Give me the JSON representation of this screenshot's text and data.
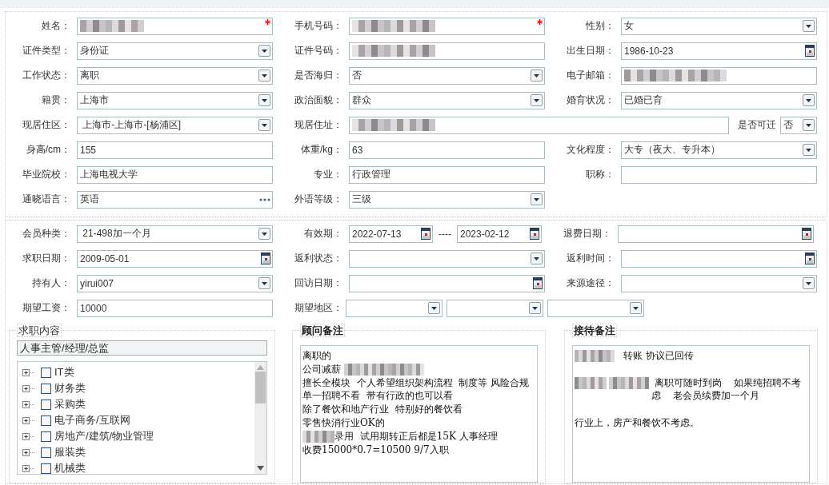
{
  "basic_info": {
    "rows": [
      [
        {
          "label": "姓名：",
          "kind": "text",
          "redacted": true,
          "required": true
        },
        {
          "label": "手机号码：",
          "kind": "text",
          "redacted": true,
          "required": true
        },
        {
          "label": "性别：",
          "kind": "select",
          "value": "女"
        }
      ],
      [
        {
          "label": "证件类型：",
          "kind": "select",
          "value": "身份证"
        },
        {
          "label": "证件号码：",
          "kind": "text",
          "redacted": true
        },
        {
          "label": "出生日期：",
          "kind": "date",
          "value": "1986-10-23"
        }
      ],
      [
        {
          "label": "工作状态：",
          "kind": "select",
          "value": "离职"
        },
        {
          "label": "是否海归：",
          "kind": "select",
          "value": "否"
        },
        {
          "label": "电子邮箱：",
          "kind": "text",
          "redacted": true
        }
      ],
      [
        {
          "label": "籍贯：",
          "kind": "select",
          "value": "上海市"
        },
        {
          "label": "政治面貌：",
          "kind": "select",
          "value": "群众"
        },
        {
          "label": "婚育状况：",
          "kind": "select",
          "value": "已婚已育"
        }
      ],
      [
        {
          "label": "现居住区：",
          "kind": "select",
          "value": " 上海市-上海市-[杨浦区]"
        },
        {
          "label": "现居住址：",
          "kind": "text",
          "redacted": true,
          "extra": {
            "label": "是否可迁",
            "value": "否"
          }
        }
      ],
      [
        {
          "label": "身高/cm：",
          "kind": "text",
          "value": "155"
        },
        {
          "label": "体重/kg：",
          "kind": "text",
          "value": "63"
        },
        {
          "label": "文化程度：",
          "kind": "select",
          "value": "大专（夜大、专升本）"
        }
      ],
      [
        {
          "label": "毕业院校：",
          "kind": "text",
          "value": "上海电视大学"
        },
        {
          "label": "专业：",
          "kind": "text",
          "value": "行政管理"
        },
        {
          "label": "职称：",
          "kind": "text"
        }
      ],
      [
        {
          "label": "通晓语言：",
          "kind": "picker",
          "value": "英语"
        },
        {
          "label": "外语等级：",
          "kind": "select",
          "value": "三级"
        }
      ]
    ]
  },
  "membership": {
    "rows": [
      [
        {
          "label": "会员种类：",
          "kind": "select",
          "value": " 21-498加一个月"
        },
        {
          "label": "有效期：",
          "kind": "daterange",
          "from": "2022-07-13",
          "separator": "----",
          "to": "2023-02-12"
        },
        {
          "label": "退费日期：",
          "kind": "date"
        }
      ],
      [
        {
          "label": "求职日期：",
          "kind": "date",
          "value": "2009-05-01"
        },
        {
          "label": "返利状态：",
          "kind": "select"
        },
        {
          "label": "返利时间：",
          "kind": "date"
        }
      ],
      [
        {
          "label": "持有人：",
          "kind": "select",
          "value": "yirui007"
        },
        {
          "label": "回访日期：",
          "kind": "date"
        },
        {
          "label": "来源途径：",
          "kind": "select"
        }
      ],
      [
        {
          "label": "期望工资：",
          "kind": "text",
          "value": "10000"
        },
        {
          "label": "期望地区：",
          "kind": "region",
          "parts": [
            {
              "kind": "select"
            },
            {
              "kind": "select"
            },
            {
              "kind": "select"
            }
          ]
        }
      ]
    ]
  },
  "job_content": {
    "legend": "求职内容",
    "path": "人事主管/经理/总监",
    "tree": [
      {
        "label": "IT类",
        "expanded": false,
        "checked": false
      },
      {
        "label": "财务类",
        "expanded": false,
        "checked": false
      },
      {
        "label": "采购类",
        "expanded": false,
        "checked": false
      },
      {
        "label": "电子商务/互联网",
        "expanded": false,
        "checked": false
      },
      {
        "label": "房地产/建筑/物业管理",
        "expanded": false,
        "checked": false
      },
      {
        "label": "服装类",
        "expanded": false,
        "checked": false
      },
      {
        "label": "机械类",
        "expanded": false,
        "checked": false
      }
    ]
  },
  "notes": [
    {
      "legend": "顾问备注",
      "paragraphs": [
        {
          "kind": "line",
          "segments": [
            {
              "kind": "text",
              "text": "离职的"
            }
          ]
        },
        {
          "kind": "line",
          "segments": [
            {
              "kind": "text",
              "text": "公司减薪 "
            },
            {
              "kind": "redacted"
            },
            {
              "kind": "redacted"
            }
          ]
        },
        {
          "kind": "line",
          "segments": [
            {
              "kind": "text",
              "text": "擅长全模块  个人希望组织架构流程  制度等 风险合规"
            }
          ]
        },
        {
          "kind": "line",
          "segments": [
            {
              "kind": "text",
              "text": "单一招聘不看  带有行政的也可以看"
            }
          ]
        },
        {
          "kind": "line",
          "segments": [
            {
              "kind": "text",
              "text": "除了餐饮和地产行业  特别好的餐饮看"
            }
          ]
        },
        {
          "kind": "line",
          "segments": [
            {
              "kind": "text",
              "text": "零售快消行业OK的"
            }
          ]
        },
        {
          "kind": "line",
          "segments": [
            {
              "kind": "redacted"
            },
            {
              "kind": "text",
              "text": "录用  试用期转正后都是15K 人事经理"
            }
          ]
        },
        {
          "kind": "line",
          "segments": [
            {
              "kind": "text",
              "text": "收费15000*0.7=10500 9/7入职"
            }
          ]
        }
      ]
    },
    {
      "legend": "接待备注",
      "paragraphs": [
        {
          "kind": "line",
          "segments": [
            {
              "kind": "redacted"
            },
            {
              "kind": "text",
              "text": "   转账 协议已回传"
            }
          ]
        },
        {
          "kind": "blank"
        },
        {
          "kind": "wrapped",
          "segments": [
            {
              "kind": "redacted"
            },
            {
              "kind": "redacted"
            },
            {
              "kind": "text",
              "text": " 离职可随时到岗    如果纯招聘不考虑    老会员续费加一个月"
            }
          ]
        },
        {
          "kind": "blank"
        },
        {
          "kind": "line",
          "segments": [
            {
              "kind": "text",
              "text": "行业上，房产和餐饮不考虑。"
            }
          ]
        }
      ]
    }
  ]
}
